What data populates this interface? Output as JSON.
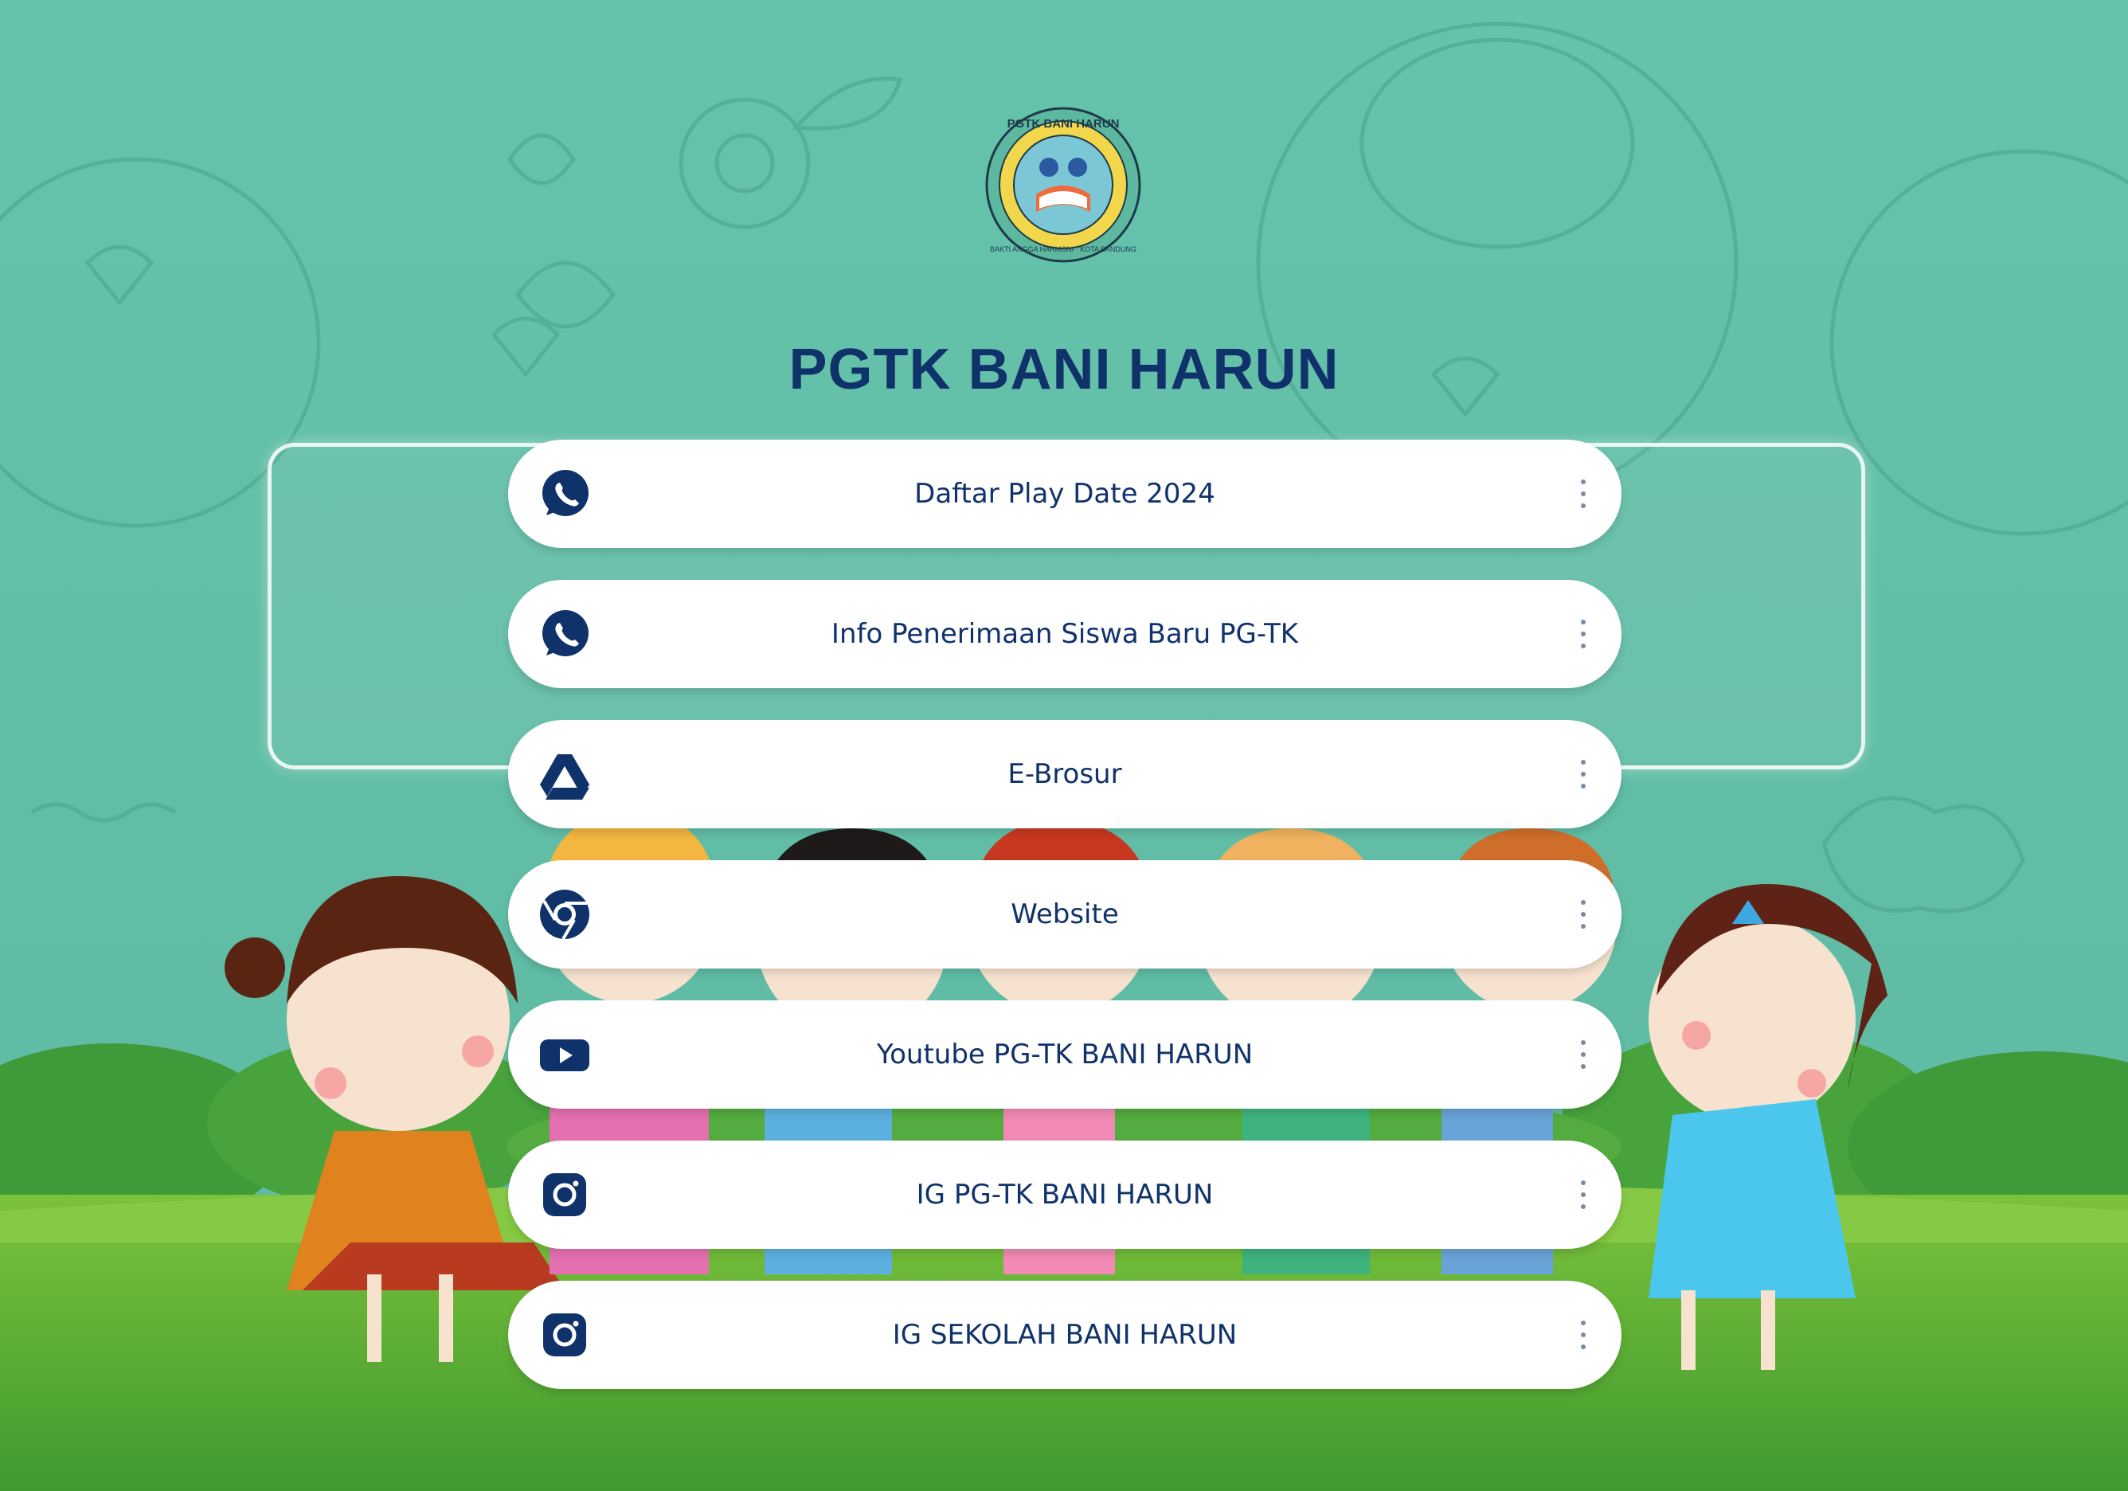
{
  "page": {
    "title": "PGTK BANI HARUN",
    "logo": {
      "top_text": "PGTK BANI HARUN",
      "bottom_text": "BAKTI ANGGA HARMONI · KOTA BANDUNG"
    }
  },
  "colors": {
    "background": "#63c0a8",
    "accent": "#10326b",
    "grass": "#4fa83a",
    "button_bg": "#ffffff"
  },
  "links": [
    {
      "label": "Daftar Play Date 2024",
      "icon": "whatsapp-icon"
    },
    {
      "label": "Info Penerimaan Siswa Baru PG-TK",
      "icon": "whatsapp-icon"
    },
    {
      "label": "E-Brosur",
      "icon": "google-drive-icon"
    },
    {
      "label": "Website",
      "icon": "chrome-icon"
    },
    {
      "label": "Youtube PG-TK BANI HARUN",
      "icon": "youtube-icon"
    },
    {
      "label": "IG PG-TK BANI HARUN",
      "icon": "instagram-icon"
    },
    {
      "label": "IG SEKOLAH BANI HARUN",
      "icon": "instagram-icon"
    }
  ]
}
